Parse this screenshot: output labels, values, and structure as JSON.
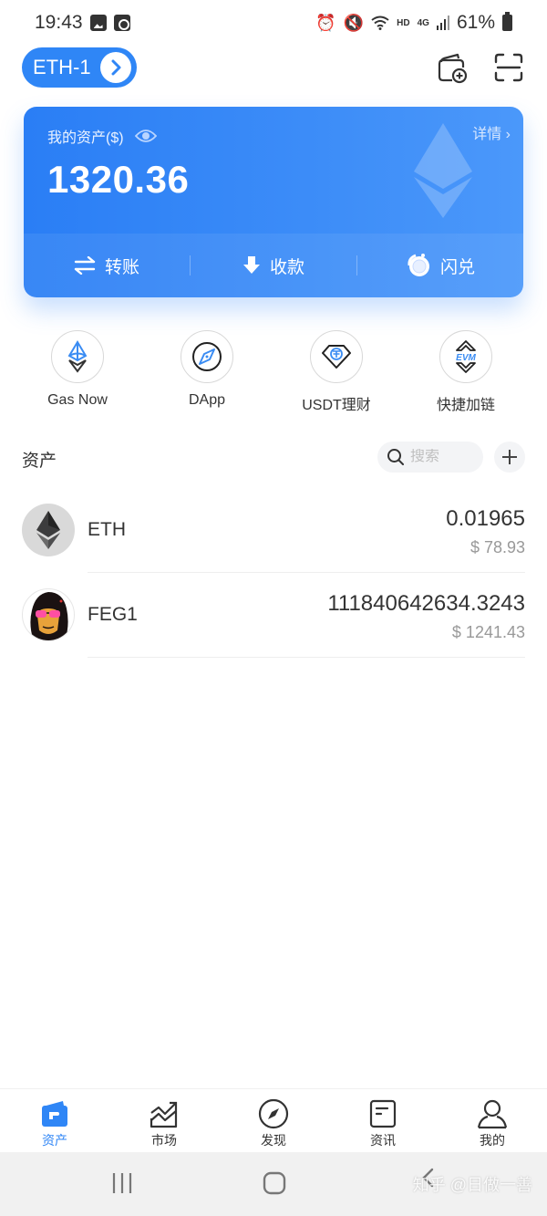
{
  "status_bar": {
    "time": "19:43",
    "network_hd": "HD",
    "network_type": "4G",
    "battery": "61%"
  },
  "header": {
    "wallet_name": "ETH-1",
    "icons": [
      "wallet-add-icon",
      "scan-icon"
    ]
  },
  "asset_card": {
    "label": "我的资产($)",
    "total": "1320.36",
    "detail_link": "详情",
    "actions": [
      {
        "label": "转账",
        "icon": "transfer-icon"
      },
      {
        "label": "收款",
        "icon": "receive-icon"
      },
      {
        "label": "闪兑",
        "icon": "swap-icon"
      }
    ]
  },
  "quick_actions": [
    {
      "label": "Gas Now",
      "icon": "gas-icon"
    },
    {
      "label": "DApp",
      "icon": "compass-icon"
    },
    {
      "label": "USDT理财",
      "icon": "usdt-icon"
    },
    {
      "label": "快捷加链",
      "icon": "evm-icon"
    }
  ],
  "assets": {
    "title": "资产",
    "search_placeholder": "搜索",
    "tokens": [
      {
        "symbol": "ETH",
        "amount": "0.01965",
        "value": "$ 78.93"
      },
      {
        "symbol": "FEG1",
        "amount": "111840642634.3243",
        "value": "$ 1241.43"
      }
    ]
  },
  "tab_bar": {
    "items": [
      {
        "label": "资产",
        "active": true
      },
      {
        "label": "市场",
        "active": false
      },
      {
        "label": "发现",
        "active": false
      },
      {
        "label": "资讯",
        "active": false
      },
      {
        "label": "我的",
        "active": false
      }
    ]
  },
  "watermark": "知乎 @日做一善",
  "colors": {
    "accent": "#2f86f6",
    "card_start": "#2a7ef5",
    "card_end": "#4b98fa",
    "muted_text": "#999999"
  }
}
